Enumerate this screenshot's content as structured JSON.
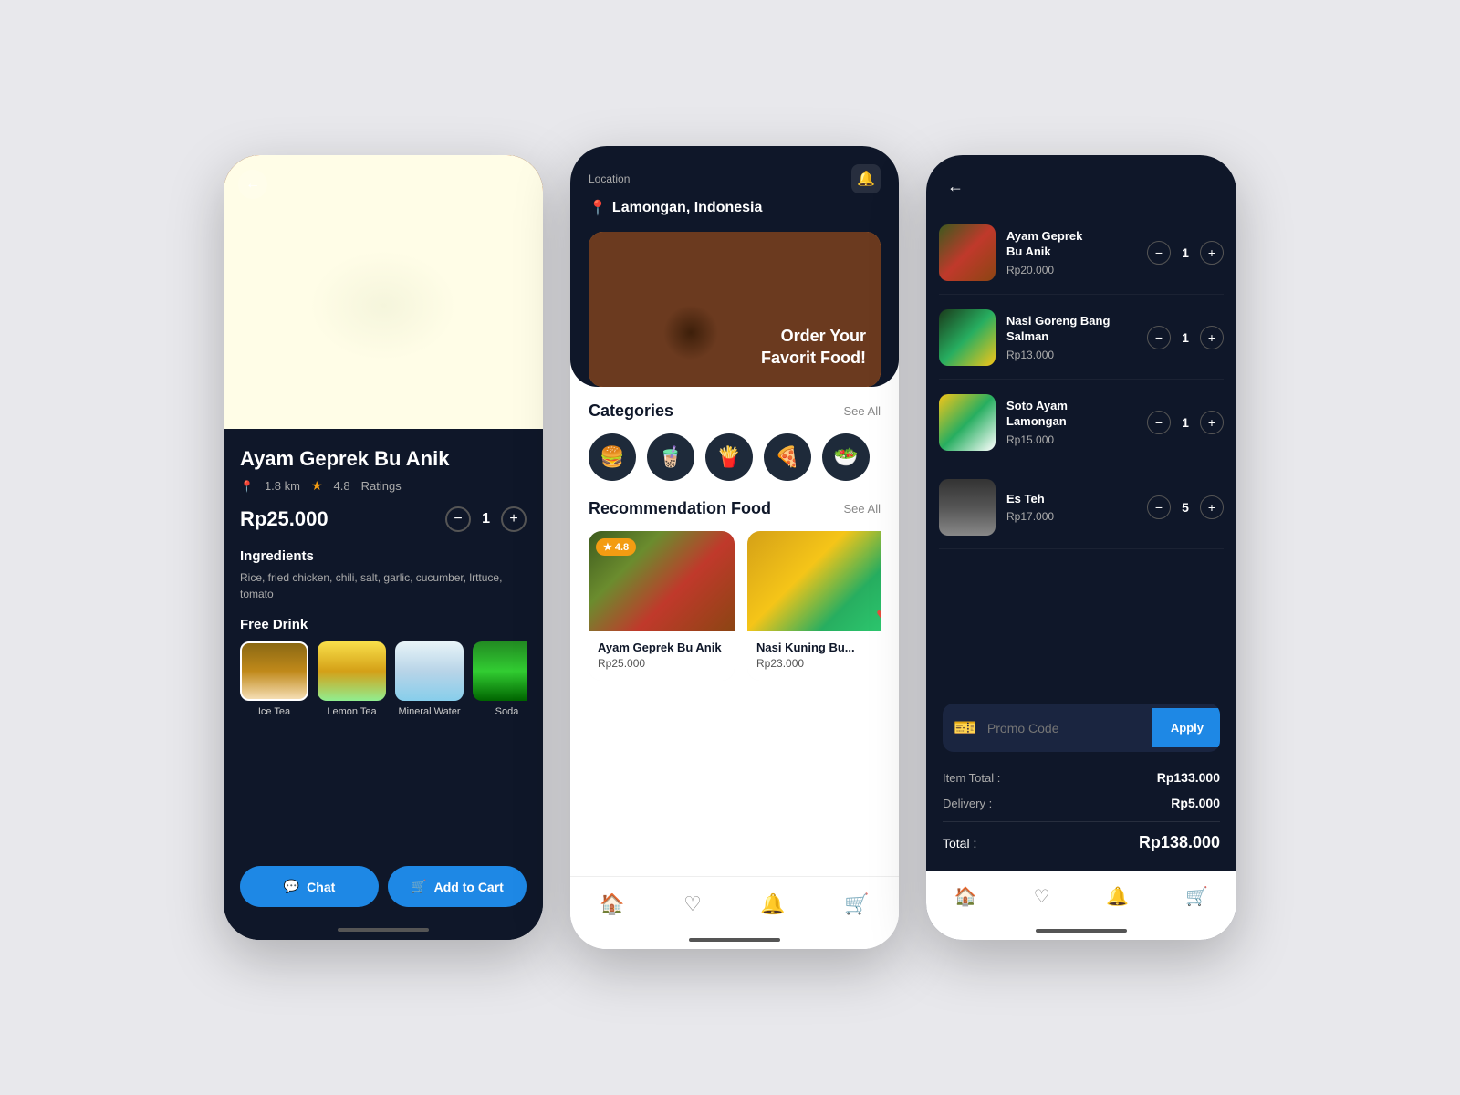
{
  "phone1": {
    "back_label": "←",
    "food_name": "Ayam Geprek Bu Anik",
    "distance": "1.8 km",
    "rating": "4.8",
    "rating_label": "Ratings",
    "price": "Rp25.000",
    "qty": "1",
    "ingredients_title": "Ingredients",
    "ingredients": "Rice, fried chicken, chili, salt, garlic, cucumber, lrttuce, tomato",
    "free_drink_title": "Free Drink",
    "drinks": [
      {
        "label": "Ice Tea",
        "type": "ice-tea"
      },
      {
        "label": "Lemon Tea",
        "type": "lemon-tea"
      },
      {
        "label": "Mineral Water",
        "type": "mineral"
      },
      {
        "label": "Soda",
        "type": "soda"
      }
    ],
    "chat_btn": "Chat",
    "cart_btn": "Add to Cart"
  },
  "phone2": {
    "location_label": "Location",
    "location_name": "Lamongan, Indonesia",
    "banner_text": "Order Your\nFavorit Food!",
    "categories_title": "Categories",
    "see_all": "See All",
    "recommendation_title": "Recommendation Food",
    "categories": [
      "🍔",
      "🧋",
      "🍟",
      "🍕",
      "🥗"
    ],
    "food_cards": [
      {
        "name": "Ayam Geprek Bu Anik",
        "price": "Rp25.000",
        "rating": "4.8",
        "type": "geprek"
      },
      {
        "name": "Nasi Kuning Bu...",
        "price": "Rp23.000",
        "type": "nasi-kuning"
      }
    ]
  },
  "phone3": {
    "back_label": "←",
    "cart_items": [
      {
        "name": "Ayam Geprek\nBu Anik",
        "price": "Rp20.000",
        "qty": "1",
        "img": "ci1"
      },
      {
        "name": "Nasi Goreng Bang\nSalman",
        "price": "Rp13.000",
        "qty": "1",
        "img": "ci2"
      },
      {
        "name": "Soto Ayam\nLamongan",
        "price": "Rp15.000",
        "qty": "1",
        "img": "ci3"
      },
      {
        "name": "Es Teh",
        "price": "Rp17.000",
        "qty": "5",
        "img": "ci4"
      }
    ],
    "promo_placeholder": "Promo Code",
    "apply_btn": "Apply",
    "item_total_label": "Item Total :",
    "item_total_value": "Rp133.000",
    "delivery_label": "Delivery :",
    "delivery_value": "Rp5.000",
    "total_label": "Total :",
    "total_value": "Rp138.000"
  }
}
